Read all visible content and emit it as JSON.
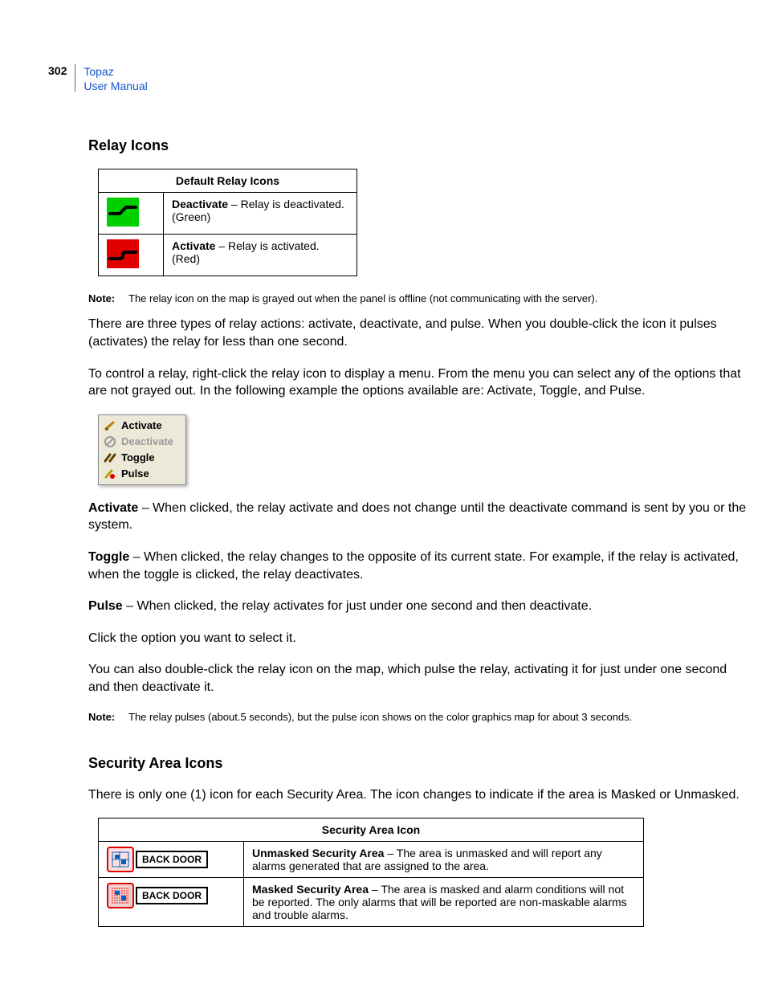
{
  "header": {
    "page_number": "302",
    "doc_line1": "Topaz",
    "doc_line2": "User Manual"
  },
  "section1": {
    "heading": "Relay Icons",
    "table_header": "Default Relay Icons",
    "row1_bold": "Deactivate",
    "row1_rest": " – Relay is deactivated. (Green)",
    "row2_bold": "Activate",
    "row2_rest": " – Relay is activated. (Red)",
    "note1_label": "Note:",
    "note1_text": "The relay icon on the map is grayed out when the panel is offline (not communicating with the server).",
    "p1": "There are three types of relay actions: activate, deactivate, and pulse. When you double-click the icon it pulses (activates) the relay for less than one second.",
    "p2": "To control a relay, right-click the relay icon to display a menu. From the menu you can select any of the options that are not grayed out. In the following example the options available are: Activate, Toggle, and Pulse.",
    "menu": {
      "activate": "Activate",
      "deactivate": "Deactivate",
      "toggle": "Toggle",
      "pulse": "Pulse"
    },
    "act_bold": "Activate",
    "act_rest": " – When clicked, the relay activate and does not change until the deactivate command is sent by you or the system.",
    "tog_bold": "Toggle",
    "tog_rest": " – When clicked, the relay changes to the opposite of its current state. For example, if the relay is activated, when the toggle is clicked, the relay deactivates.",
    "pul_bold": "Pulse",
    "pul_rest": " – When clicked, the relay activates for just under one second and then deactivate.",
    "p_click": "Click the option you want to select it.",
    "p_dbl": "You can also double-click the relay icon on the map, which pulse the relay, activating it for just under one second and then deactivate it.",
    "note2_label": "Note:",
    "note2_text": "The relay pulses (about.5 seconds), but the pulse icon shows on the color graphics map for about 3 seconds."
  },
  "section2": {
    "heading": "Security Area Icons",
    "intro": "There is only one (1) icon for each Security Area. The icon changes to indicate if the area is Masked or Unmasked.",
    "table_header": "Security Area Icon",
    "row1_label": "BACK DOOR",
    "row1_bold": "Unmasked Security Area",
    "row1_rest": " – The area is unmasked and will report any alarms generated that are assigned to the area.",
    "row2_label": "BACK DOOR",
    "row2_bold": "Masked Security Area",
    "row2_rest": " – The area is masked and alarm conditions will not be reported. The only alarms that will be reported are non-maskable alarms and trouble alarms."
  }
}
